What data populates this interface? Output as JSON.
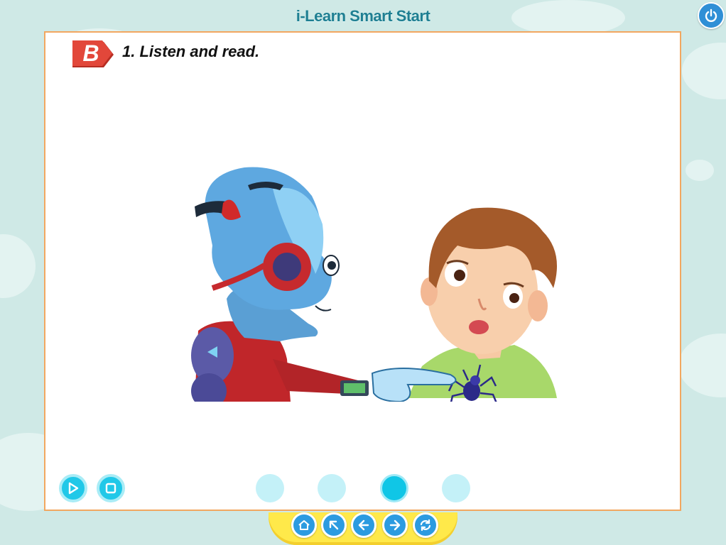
{
  "app": {
    "title": "i-Learn Smart Start"
  },
  "lesson": {
    "section_letter": "B",
    "instruction": "1. Listen and read."
  },
  "audio_controls": [
    {
      "name": "play-button",
      "icon": "play-icon"
    },
    {
      "name": "stop-button",
      "icon": "stop-icon"
    }
  ],
  "page_dots": {
    "count": 4,
    "active_index": 3
  },
  "nav_buttons": [
    {
      "name": "home-button",
      "icon": "home-icon"
    },
    {
      "name": "back-up-button",
      "icon": "arrow-up-left-icon"
    },
    {
      "name": "previous-button",
      "icon": "arrow-left-icon"
    },
    {
      "name": "next-button",
      "icon": "arrow-right-icon"
    },
    {
      "name": "refresh-button",
      "icon": "refresh-icon"
    }
  ],
  "colors": {
    "background": "#cfe9e6",
    "panel_border": "#f2a760",
    "accent_cyan": "#20c8e8",
    "nav_blue": "#2c9be0",
    "tray_yellow": "#ffe94a",
    "badge_red": "#d9402f"
  }
}
